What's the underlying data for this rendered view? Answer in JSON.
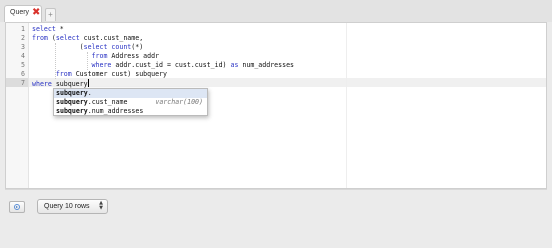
{
  "tabs": [
    {
      "label": "Query",
      "close_icon": "close-icon",
      "close_glyph": "✖",
      "active": true
    }
  ],
  "new_tab_glyph": "+",
  "editor": {
    "line_numbers": [
      "1",
      "2",
      "3",
      "4",
      "5",
      "6",
      "7"
    ],
    "active_line": 7,
    "lines": [
      "select *",
      "from (select cust.cust_name,",
      "            (select count(*)",
      "               from Address addr",
      "               where addr.cust_id = cust.cust_id) as num_addresses",
      "      from Customer cust) subquery",
      "where subquery"
    ]
  },
  "autocomplete": {
    "items": [
      {
        "match": "subquery",
        "rest": ".",
        "type": "",
        "selected": true
      },
      {
        "match": "subquery",
        "rest": ".cust_name",
        "type": "varchar(100)",
        "selected": false
      },
      {
        "match": "subquery",
        "rest": ".num_addresses",
        "type": "",
        "selected": false
      }
    ]
  },
  "toolbar": {
    "run_icon": "play-icon",
    "rows_select": {
      "value": "Query 10 rows",
      "arrow_icon": "select-arrows-icon",
      "arrow_up": "▲",
      "arrow_down": "▼"
    }
  },
  "colors": {
    "keyword": "#2a33c4",
    "close": "#d9322c",
    "selection": "#dde6f4"
  }
}
